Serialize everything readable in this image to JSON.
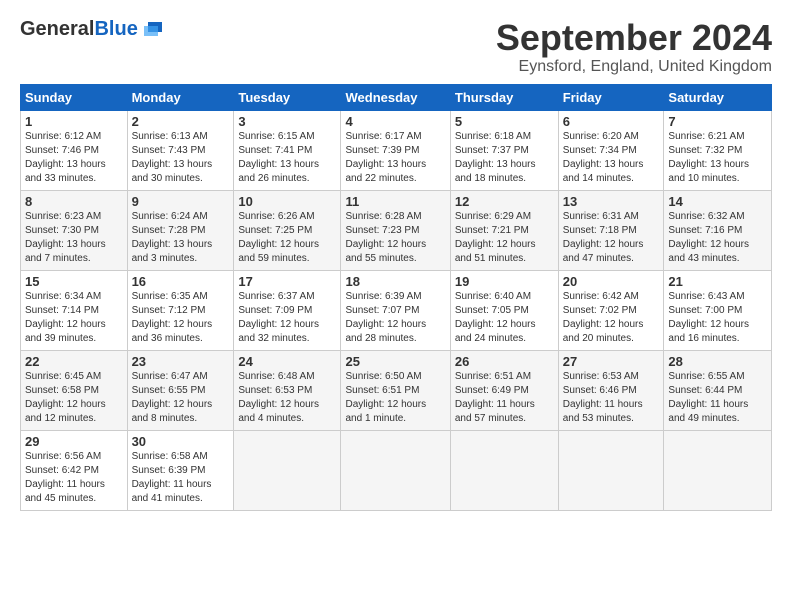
{
  "header": {
    "logo_general": "General",
    "logo_blue": "Blue",
    "month_title": "September 2024",
    "location": "Eynsford, England, United Kingdom"
  },
  "weekdays": [
    "Sunday",
    "Monday",
    "Tuesday",
    "Wednesday",
    "Thursday",
    "Friday",
    "Saturday"
  ],
  "weeks": [
    [
      {
        "day": "1",
        "info": "Sunrise: 6:12 AM\nSunset: 7:46 PM\nDaylight: 13 hours\nand 33 minutes."
      },
      {
        "day": "2",
        "info": "Sunrise: 6:13 AM\nSunset: 7:43 PM\nDaylight: 13 hours\nand 30 minutes."
      },
      {
        "day": "3",
        "info": "Sunrise: 6:15 AM\nSunset: 7:41 PM\nDaylight: 13 hours\nand 26 minutes."
      },
      {
        "day": "4",
        "info": "Sunrise: 6:17 AM\nSunset: 7:39 PM\nDaylight: 13 hours\nand 22 minutes."
      },
      {
        "day": "5",
        "info": "Sunrise: 6:18 AM\nSunset: 7:37 PM\nDaylight: 13 hours\nand 18 minutes."
      },
      {
        "day": "6",
        "info": "Sunrise: 6:20 AM\nSunset: 7:34 PM\nDaylight: 13 hours\nand 14 minutes."
      },
      {
        "day": "7",
        "info": "Sunrise: 6:21 AM\nSunset: 7:32 PM\nDaylight: 13 hours\nand 10 minutes."
      }
    ],
    [
      {
        "day": "8",
        "info": "Sunrise: 6:23 AM\nSunset: 7:30 PM\nDaylight: 13 hours\nand 7 minutes."
      },
      {
        "day": "9",
        "info": "Sunrise: 6:24 AM\nSunset: 7:28 PM\nDaylight: 13 hours\nand 3 minutes."
      },
      {
        "day": "10",
        "info": "Sunrise: 6:26 AM\nSunset: 7:25 PM\nDaylight: 12 hours\nand 59 minutes."
      },
      {
        "day": "11",
        "info": "Sunrise: 6:28 AM\nSunset: 7:23 PM\nDaylight: 12 hours\nand 55 minutes."
      },
      {
        "day": "12",
        "info": "Sunrise: 6:29 AM\nSunset: 7:21 PM\nDaylight: 12 hours\nand 51 minutes."
      },
      {
        "day": "13",
        "info": "Sunrise: 6:31 AM\nSunset: 7:18 PM\nDaylight: 12 hours\nand 47 minutes."
      },
      {
        "day": "14",
        "info": "Sunrise: 6:32 AM\nSunset: 7:16 PM\nDaylight: 12 hours\nand 43 minutes."
      }
    ],
    [
      {
        "day": "15",
        "info": "Sunrise: 6:34 AM\nSunset: 7:14 PM\nDaylight: 12 hours\nand 39 minutes."
      },
      {
        "day": "16",
        "info": "Sunrise: 6:35 AM\nSunset: 7:12 PM\nDaylight: 12 hours\nand 36 minutes."
      },
      {
        "day": "17",
        "info": "Sunrise: 6:37 AM\nSunset: 7:09 PM\nDaylight: 12 hours\nand 32 minutes."
      },
      {
        "day": "18",
        "info": "Sunrise: 6:39 AM\nSunset: 7:07 PM\nDaylight: 12 hours\nand 28 minutes."
      },
      {
        "day": "19",
        "info": "Sunrise: 6:40 AM\nSunset: 7:05 PM\nDaylight: 12 hours\nand 24 minutes."
      },
      {
        "day": "20",
        "info": "Sunrise: 6:42 AM\nSunset: 7:02 PM\nDaylight: 12 hours\nand 20 minutes."
      },
      {
        "day": "21",
        "info": "Sunrise: 6:43 AM\nSunset: 7:00 PM\nDaylight: 12 hours\nand 16 minutes."
      }
    ],
    [
      {
        "day": "22",
        "info": "Sunrise: 6:45 AM\nSunset: 6:58 PM\nDaylight: 12 hours\nand 12 minutes."
      },
      {
        "day": "23",
        "info": "Sunrise: 6:47 AM\nSunset: 6:55 PM\nDaylight: 12 hours\nand 8 minutes."
      },
      {
        "day": "24",
        "info": "Sunrise: 6:48 AM\nSunset: 6:53 PM\nDaylight: 12 hours\nand 4 minutes."
      },
      {
        "day": "25",
        "info": "Sunrise: 6:50 AM\nSunset: 6:51 PM\nDaylight: 12 hours\nand 1 minute."
      },
      {
        "day": "26",
        "info": "Sunrise: 6:51 AM\nSunset: 6:49 PM\nDaylight: 11 hours\nand 57 minutes."
      },
      {
        "day": "27",
        "info": "Sunrise: 6:53 AM\nSunset: 6:46 PM\nDaylight: 11 hours\nand 53 minutes."
      },
      {
        "day": "28",
        "info": "Sunrise: 6:55 AM\nSunset: 6:44 PM\nDaylight: 11 hours\nand 49 minutes."
      }
    ],
    [
      {
        "day": "29",
        "info": "Sunrise: 6:56 AM\nSunset: 6:42 PM\nDaylight: 11 hours\nand 45 minutes."
      },
      {
        "day": "30",
        "info": "Sunrise: 6:58 AM\nSunset: 6:39 PM\nDaylight: 11 hours\nand 41 minutes."
      },
      {
        "day": "",
        "info": ""
      },
      {
        "day": "",
        "info": ""
      },
      {
        "day": "",
        "info": ""
      },
      {
        "day": "",
        "info": ""
      },
      {
        "day": "",
        "info": ""
      }
    ]
  ]
}
